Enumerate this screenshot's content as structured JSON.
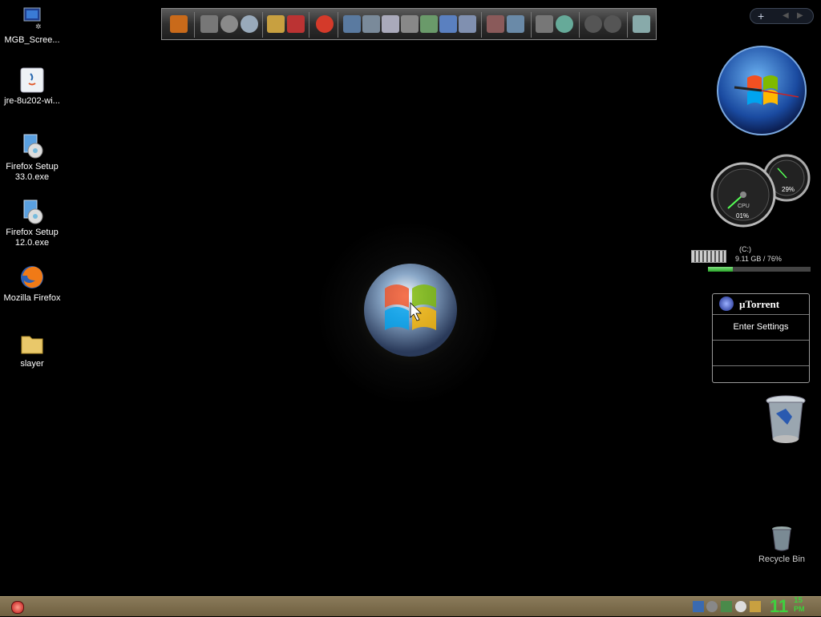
{
  "desktop_icons": [
    {
      "label": "MGB_Scree...",
      "icon": "screenshot-app-icon"
    },
    {
      "label": "jre-8u202-wi...",
      "icon": "java-installer-icon"
    },
    {
      "label": "Firefox Setup 33.0.exe",
      "icon": "installer-icon"
    },
    {
      "label": "Firefox Setup 12.0.exe",
      "icon": "installer-icon"
    },
    {
      "label": "Mozilla Firefox",
      "icon": "firefox-icon"
    },
    {
      "label": "slayer",
      "icon": "folder-icon"
    }
  ],
  "gauges": {
    "cpu_label": "CPU",
    "cpu_value": "01%",
    "mem_value": "29%"
  },
  "drive": {
    "label": "(C:)",
    "usage": "9.11 GB / 76%",
    "fill_fraction": 0.24
  },
  "utorrent": {
    "title": "µTorrent",
    "link": "Enter Settings"
  },
  "recycle_bin": {
    "label": "Recycle Bin"
  },
  "clock": {
    "hour": "11",
    "minute": "15",
    "ampm": "PM"
  },
  "colors": {
    "desktop": "#000000",
    "taskbar": "#7a6a4a",
    "clock_green": "#3ed13e"
  }
}
